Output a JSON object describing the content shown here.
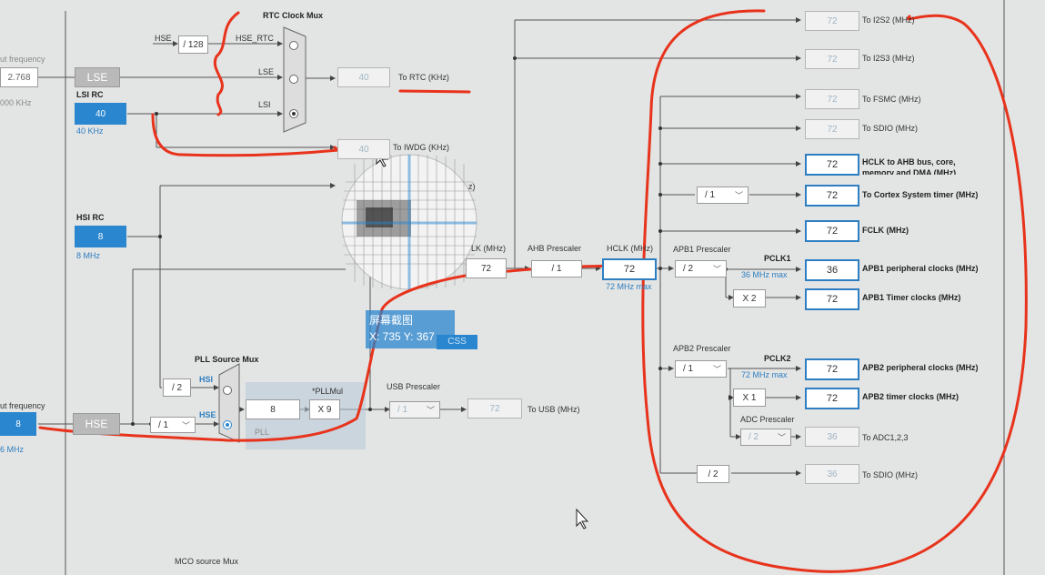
{
  "left_panel": {
    "input_freq_top": "ut frequency",
    "lse_value": "2.768",
    "lse_unit": "000 KHz",
    "lse_label": "LSE",
    "lsi_title": "LSI RC",
    "lsi_value": "40",
    "lsi_unit": "40 KHz",
    "hsi_title": "HSI RC",
    "hsi_value": "8",
    "hsi_unit": "8 MHz",
    "input_freq_bottom": "ut frequency",
    "hse_value": "8",
    "hse_unit": "6 MHz",
    "hse_label": "HSE"
  },
  "rtc": {
    "mux_title": "RTC Clock Mux",
    "hse_in": "HSE",
    "div128": "/ 128",
    "hse_rtc": "HSE_RTC",
    "lse": "LSE",
    "lsi": "LSI",
    "value": "40",
    "to_rtc": "To RTC (KHz)",
    "iwdg_value": "40",
    "to_iwdg": "To IWDG (KHz)"
  },
  "pll": {
    "mux_title": "PLL Source Mux",
    "hsi": "HSI",
    "hse": "HSE",
    "div2": "/ 2",
    "hse_div": "/ 1",
    "pll_value": "8",
    "mul_title": "*PLLMul",
    "mul_value": "X 9",
    "pll_label": "PLL"
  },
  "usb": {
    "title": "USB Prescaler",
    "div": "/ 1",
    "value": "72",
    "to_usb": "To USB (MHz)"
  },
  "sysclk": {
    "label": "LK (MHz)",
    "value": "72",
    "ahb_title": "AHB Prescaler",
    "ahb_value": "/ 1",
    "hclk_title": "HCLK (MHz)",
    "hclk_value": "72",
    "hclk_max": "72 MHz max",
    "css": "CSS"
  },
  "magnifier": {
    "caption": "屏幕截图",
    "coords": "X: 735 Y: 367",
    "partial": "z)"
  },
  "outputs": {
    "i2s2_value": "72",
    "i2s2_label": "To I2S2 (MHz)",
    "i2s3_value": "72",
    "i2s3_label": "To I2S3 (MHz)",
    "fsmc_value": "72",
    "fsmc_label": "To FSMC (MHz)",
    "sdio_value": "72",
    "sdio_label": "To SDIO (MHz)",
    "hclk_ahb_value": "72",
    "hclk_ahb_label1": "HCLK to AHB bus, core,",
    "hclk_ahb_label2": "memory and DMA (MHz)",
    "cortex_div": "/ 1",
    "cortex_value": "72",
    "cortex_label": "To Cortex System timer (MHz)",
    "fclk_value": "72",
    "fclk_label": "FCLK (MHz)"
  },
  "apb1": {
    "title": "APB1 Prescaler",
    "div": "/ 2",
    "pclk": "PCLK1",
    "max": "36 MHz max",
    "periph_value": "36",
    "periph_label": "APB1 peripheral clocks (MHz)",
    "mul": "X 2",
    "timer_value": "72",
    "timer_label": "APB1 Timer clocks (MHz)"
  },
  "apb2": {
    "title": "APB2 Prescaler",
    "div": "/ 1",
    "pclk": "PCLK2",
    "max": "72 MHz max",
    "periph_value": "72",
    "periph_label": "APB2 peripheral clocks (MHz)",
    "mul": "X 1",
    "timer_value": "72",
    "timer_label": "APB2 timer clocks (MHz)",
    "adc_title": "ADC Prescaler",
    "adc_div": "/ 2",
    "adc_value": "36",
    "adc_label": "To ADC1,2,3",
    "sdio_div": "/ 2",
    "sdio_value": "36",
    "sdio_label": "To SDIO (MHz)"
  },
  "mco": {
    "title": "MCO source Mux"
  },
  "colors": {
    "accent": "#2a86cf",
    "annotation": "#e8331c",
    "background": "#e3e4e4"
  }
}
